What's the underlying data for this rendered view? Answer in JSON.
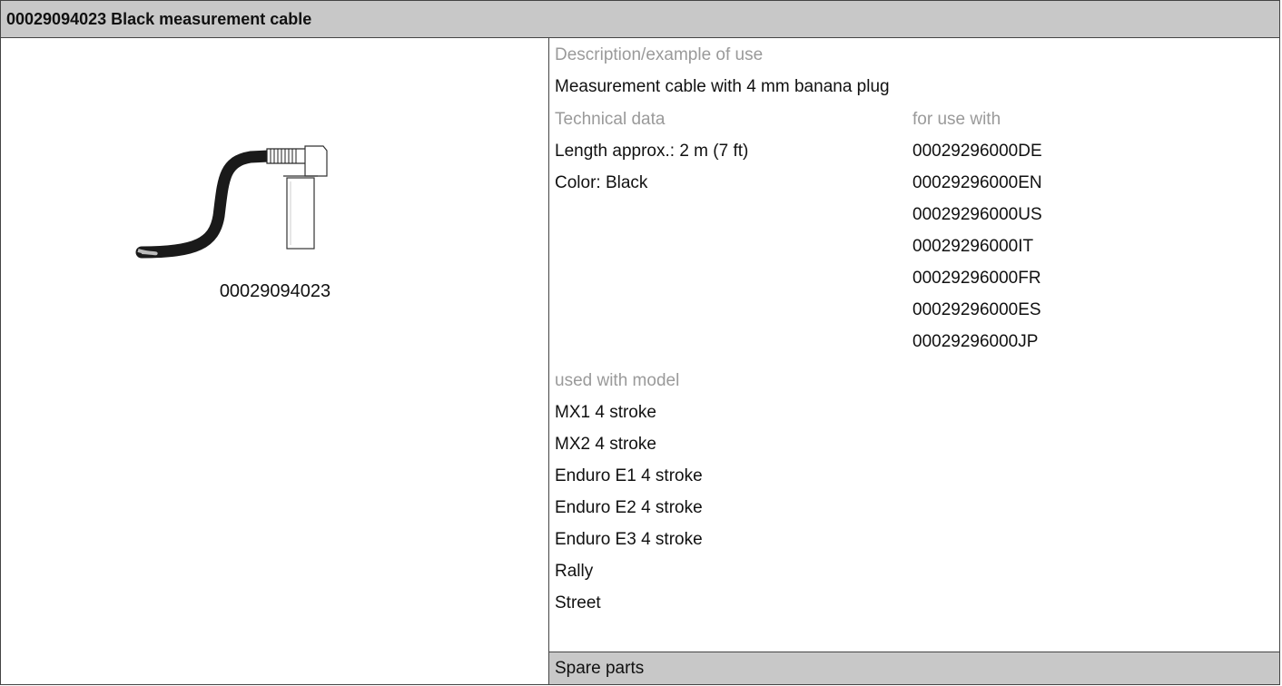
{
  "header": {
    "title": "00029094023 Black measurement cable"
  },
  "image": {
    "icon": "cable-with-banana-plug",
    "caption": "00029094023"
  },
  "description": {
    "label": "Description/example of use",
    "text": "Measurement cable with 4 mm banana plug"
  },
  "technical": {
    "label": "Technical data",
    "items": [
      "Length approx.: 2 m (7 ft)",
      "Color: Black"
    ]
  },
  "for_use_with": {
    "label": "for use with",
    "items": [
      "00029296000DE",
      "00029296000EN",
      "00029296000US",
      "00029296000IT",
      "00029296000FR",
      "00029296000ES",
      "00029296000JP"
    ]
  },
  "models": {
    "label": "used with model",
    "items": [
      "MX1 4 stroke",
      "MX2 4 stroke",
      "Enduro E1 4 stroke",
      "Enduro E2 4 stroke",
      "Enduro E3 4 stroke",
      "Rally",
      "Street"
    ]
  },
  "spare_parts": {
    "label": "Spare parts"
  }
}
